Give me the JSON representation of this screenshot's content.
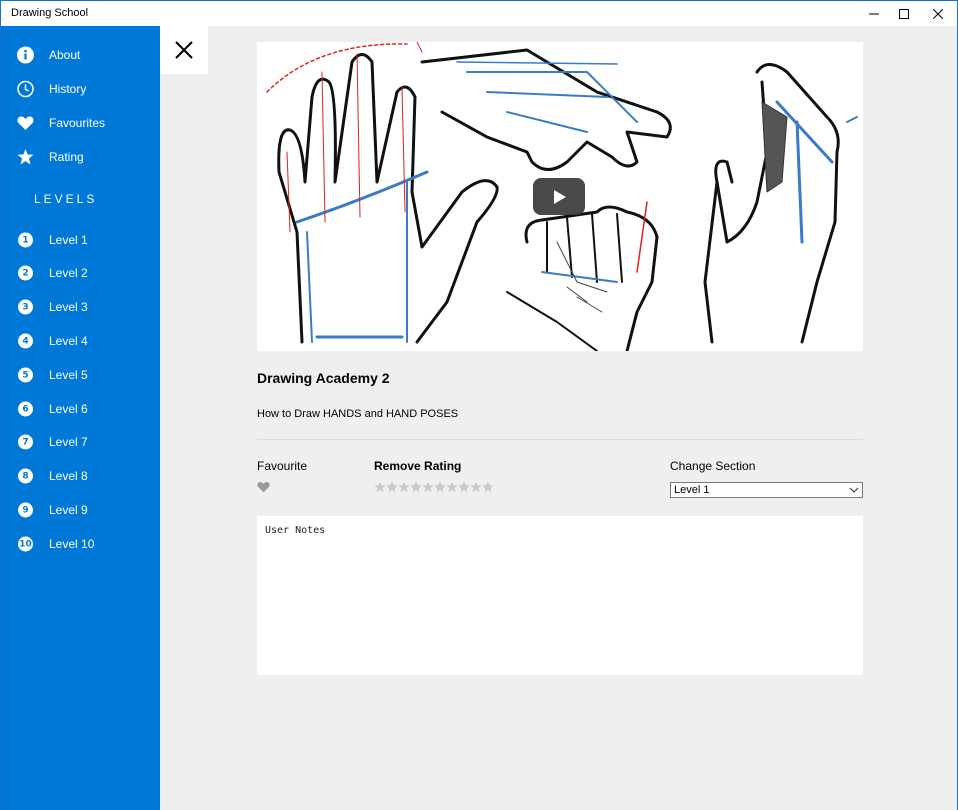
{
  "app": {
    "title": "Drawing School"
  },
  "window_controls": {
    "minimize": "minimize-icon",
    "maximize": "maximize-icon",
    "close": "close-icon"
  },
  "sidebar": {
    "menu": [
      {
        "label": "About",
        "icon": "info-icon"
      },
      {
        "label": "History",
        "icon": "clock-icon"
      },
      {
        "label": "Favourites",
        "icon": "heart-icon"
      },
      {
        "label": "Rating",
        "icon": "star-icon"
      }
    ],
    "levels_heading": "LEVELS",
    "levels": [
      {
        "num": "1",
        "label": "Level 1"
      },
      {
        "num": "2",
        "label": "Level 2"
      },
      {
        "num": "3",
        "label": "Level 3"
      },
      {
        "num": "4",
        "label": "Level 4"
      },
      {
        "num": "5",
        "label": "Level 5"
      },
      {
        "num": "6",
        "label": "Level 6"
      },
      {
        "num": "7",
        "label": "Level 7"
      },
      {
        "num": "8",
        "label": "Level 8"
      },
      {
        "num": "9",
        "label": "Level 9"
      },
      {
        "num": "10",
        "label": "Level 10"
      }
    ]
  },
  "detail": {
    "close_icon": "close-icon",
    "video_title": "Drawing Academy 2",
    "video_description": "How to Draw HANDS and HAND POSES",
    "favourite_label": "Favourite",
    "rating_label": "Remove Rating",
    "rating_star_count": 10,
    "rating_value": 0,
    "section_label": "Change Section",
    "section_selected": "Level 1",
    "notes_placeholder": "User Notes"
  },
  "colors": {
    "sidebar_bg": "#0078d7",
    "main_bg": "#efefef",
    "star_inactive": "#c8c8c8",
    "heart_inactive": "#9a9a9a"
  }
}
